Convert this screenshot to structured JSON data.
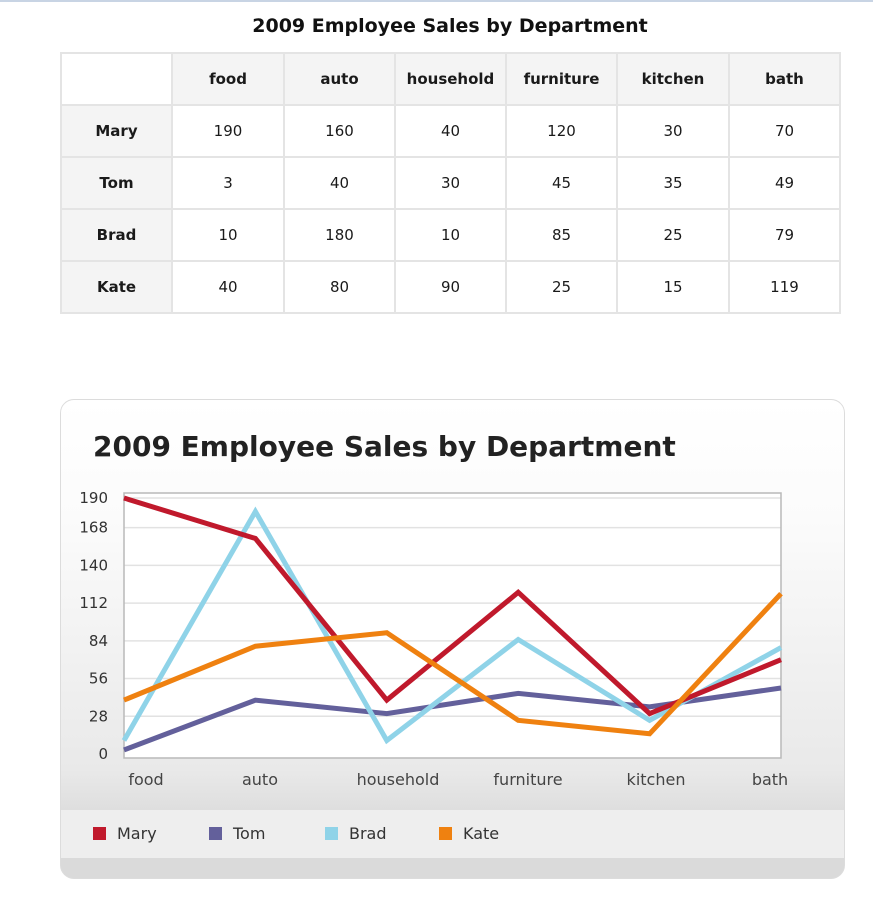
{
  "table": {
    "title": "2009 Employee Sales by Department",
    "columns": [
      "food",
      "auto",
      "household",
      "furniture",
      "kitchen",
      "bath"
    ],
    "rows": [
      {
        "name": "Mary",
        "values": [
          "190",
          "160",
          "40",
          "120",
          "30",
          "70"
        ]
      },
      {
        "name": "Tom",
        "values": [
          "3",
          "40",
          "30",
          "45",
          "35",
          "49"
        ]
      },
      {
        "name": "Brad",
        "values": [
          "10",
          "180",
          "10",
          "85",
          "25",
          "79"
        ]
      },
      {
        "name": "Kate",
        "values": [
          "40",
          "80",
          "90",
          "25",
          "15",
          "119"
        ]
      }
    ]
  },
  "chart_data": {
    "type": "line",
    "title": "2009 Employee Sales by Department",
    "xlabel": "",
    "ylabel": "",
    "categories": [
      "food",
      "auto",
      "household",
      "furniture",
      "kitchen",
      "bath"
    ],
    "yticks": [
      0,
      28,
      56,
      84,
      112,
      140,
      168,
      190
    ],
    "ylim": [
      0,
      193
    ],
    "grid": true,
    "legend_position": "bottom",
    "series": [
      {
        "name": "Mary",
        "color": "#c0192c",
        "values": [
          190,
          160,
          40,
          120,
          30,
          70
        ]
      },
      {
        "name": "Tom",
        "color": "#63609b",
        "values": [
          3,
          40,
          30,
          45,
          35,
          49
        ]
      },
      {
        "name": "Brad",
        "color": "#8fd3e8",
        "values": [
          10,
          180,
          10,
          85,
          25,
          79
        ]
      },
      {
        "name": "Kate",
        "color": "#ef8110",
        "values": [
          40,
          80,
          90,
          25,
          15,
          119
        ]
      }
    ]
  }
}
